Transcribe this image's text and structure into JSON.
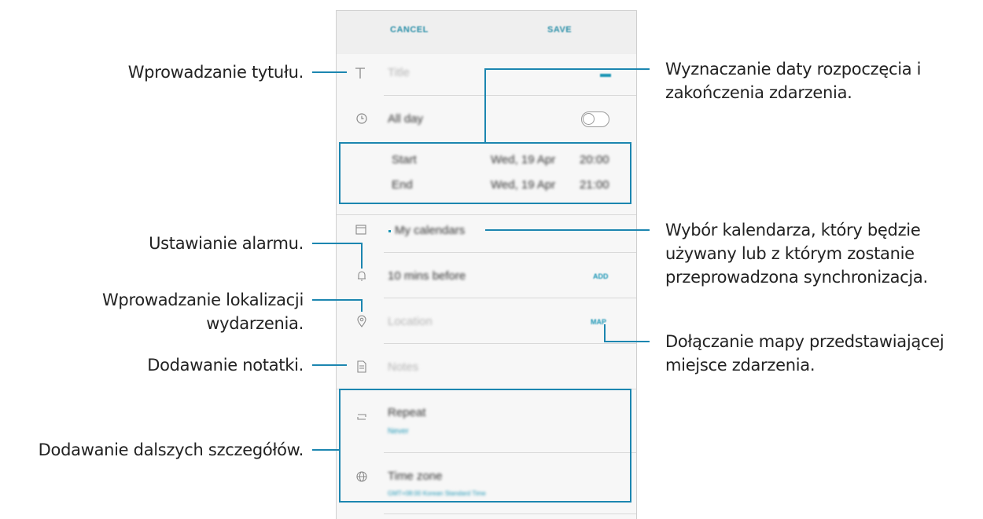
{
  "topbar": {
    "cancel_label": "CANCEL",
    "save_label": "SAVE"
  },
  "form": {
    "title_placeholder": "Title",
    "all_day_label": "All day",
    "start_label": "Start",
    "start_date": "Wed, 19 Apr",
    "start_time": "20:00",
    "end_label": "End",
    "end_date": "Wed, 19 Apr",
    "end_time": "21:00",
    "calendar_label": "My calendars",
    "alarm_label": "10 mins before",
    "alarm_action": "ADD",
    "location_placeholder": "Location",
    "map_action": "MAP",
    "notes_placeholder": "Notes",
    "repeat_label": "Repeat",
    "repeat_value": "Never",
    "timezone_label": "Time zone",
    "timezone_value": "GMT+08:00 Korean Standard Time"
  },
  "callouts": {
    "title": "Wprowadzanie tytułu.",
    "dates_line1": "Wyznaczanie daty rozpoczęcia i",
    "dates_line2": "zakończenia zdarzenia.",
    "calendar_line1": "Wybór kalendarza, który będzie",
    "calendar_line2": "używany lub z którym zostanie",
    "calendar_line3": "przeprowadzona synchronizacja.",
    "alarm": "Ustawianie alarmu.",
    "location_line1": "Wprowadzanie lokalizacji",
    "location_line2": "wydarzenia.",
    "map_line1": "Dołączanie mapy przedstawiającej",
    "map_line2": "miejsce zdarzenia.",
    "notes": "Dodawanie notatki.",
    "details": "Dodawanie dalszych szczegółów."
  },
  "colors": {
    "accent": "#1c86b0",
    "link": "#1c96b5",
    "screen_bg": "#f7f7f7"
  },
  "icons": [
    "text-title-icon",
    "clock-icon",
    "calendar-icon",
    "bell-icon",
    "location-pin-icon",
    "notes-icon",
    "repeat-icon",
    "globe-icon"
  ]
}
